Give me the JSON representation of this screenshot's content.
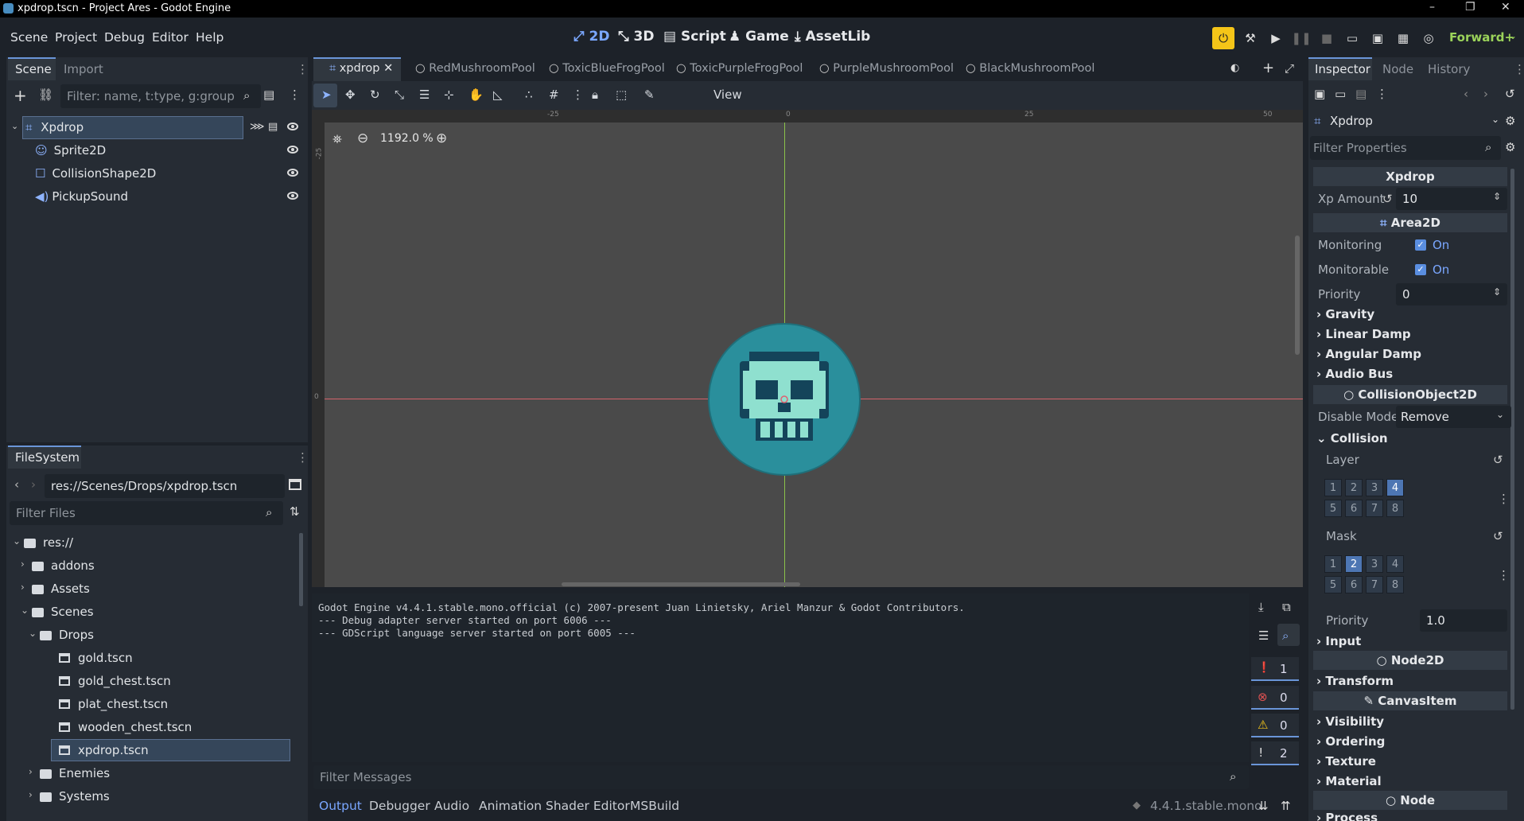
{
  "window": {
    "title": "xpdrop.tscn - Project Ares - Godot Engine",
    "minimize": "–",
    "restore": "❐",
    "close": "✕"
  },
  "menubar": {
    "menus": [
      "Scene",
      "Project",
      "Debug",
      "Editor",
      "Help"
    ],
    "main_tabs": [
      {
        "label": "2D",
        "icon": "2d-icon"
      },
      {
        "label": "3D",
        "icon": "3d-icon"
      },
      {
        "label": "Script",
        "icon": "script-icon"
      },
      {
        "label": "Game",
        "icon": "game-icon"
      },
      {
        "label": "AssetLib",
        "icon": "assetlib-icon"
      }
    ],
    "renderer": "Forward+"
  },
  "scene_dock": {
    "tabs": [
      "Scene",
      "Import"
    ],
    "filter_placeholder": "Filter: name, t:type, g:group",
    "root": "Xpdrop",
    "children": [
      "Sprite2D",
      "CollisionShape2D",
      "PickupSound"
    ]
  },
  "filesystem_dock": {
    "title": "FileSystem",
    "path": "res://Scenes/Drops/xpdrop.tscn",
    "filter_placeholder": "Filter Files",
    "tree": [
      {
        "label": "res://",
        "type": "folder",
        "depth": 0
      },
      {
        "label": "addons",
        "type": "folder",
        "depth": 1
      },
      {
        "label": "Assets",
        "type": "folder",
        "depth": 1
      },
      {
        "label": "Scenes",
        "type": "folder",
        "depth": 1
      },
      {
        "label": "Drops",
        "type": "folder",
        "depth": 2
      },
      {
        "label": "gold.tscn",
        "type": "file",
        "depth": 3
      },
      {
        "label": "gold_chest.tscn",
        "type": "file",
        "depth": 3
      },
      {
        "label": "plat_chest.tscn",
        "type": "file",
        "depth": 3
      },
      {
        "label": "wooden_chest.tscn",
        "type": "file",
        "depth": 3
      },
      {
        "label": "xpdrop.tscn",
        "type": "file",
        "depth": 3
      },
      {
        "label": "Enemies",
        "type": "folder",
        "depth": 2
      },
      {
        "label": "Systems",
        "type": "folder",
        "depth": 2
      }
    ]
  },
  "scene_tabs": [
    "xpdrop",
    "RedMushroomPool",
    "ToxicBlueFrogPool",
    "ToxicPurpleFrogPool",
    "PurpleMushroomPool",
    "BlackMushroomPool"
  ],
  "viewport": {
    "view_menu": "View",
    "zoom": "1192.0 %",
    "ruler_ticks": [
      "-25",
      "0",
      "25",
      "50"
    ],
    "ruler_left": [
      "-25",
      "0"
    ]
  },
  "output": {
    "lines": [
      "Godot Engine v4.4.1.stable.mono.official (c) 2007-present Juan Linietsky, Ariel Manzur & Godot Contributors.",
      "--- Debug adapter server started on port 6006 ---",
      "--- GDScript language server started on port 6005 ---"
    ],
    "filter_placeholder": "Filter Messages",
    "counts": [
      "1",
      "0",
      "0",
      "2"
    ]
  },
  "bottom_tabs": [
    "Output",
    "Debugger",
    "Audio",
    "Animation",
    "Shader Editor",
    "MSBuild"
  ],
  "version": "4.4.1.stable.mono",
  "inspector": {
    "tabs": [
      "Inspector",
      "Node",
      "History"
    ],
    "object": "Xpdrop",
    "filter_placeholder": "Filter Properties",
    "script_header": "Xpdrop",
    "xp_amount_label": "Xp Amount",
    "xp_amount": "10",
    "area2d": "Area2D",
    "monitoring_label": "Monitoring",
    "monitorable_label": "Monitorable",
    "on": "On",
    "priority_label": "Priority",
    "priority": "0",
    "groups": [
      "Gravity",
      "Linear Damp",
      "Angular Damp",
      "Audio Bus"
    ],
    "collision_object": "CollisionObject2D",
    "disable_mode_label": "Disable Mode",
    "disable_mode": "Remove",
    "collision": "Collision",
    "layer_label": "Layer",
    "mask_label": "Mask",
    "layer_bits": [
      "1",
      "2",
      "3",
      "4",
      "5",
      "6",
      "7",
      "8"
    ],
    "layer_on": [
      4
    ],
    "mask_on": [
      2
    ],
    "coll_priority": "1.0",
    "input": "Input",
    "node2d": "Node2D",
    "transform": "Transform",
    "canvasitem": "CanvasItem",
    "canvas_groups": [
      "Visibility",
      "Ordering",
      "Texture",
      "Material"
    ],
    "node": "Node",
    "process": "Process"
  }
}
